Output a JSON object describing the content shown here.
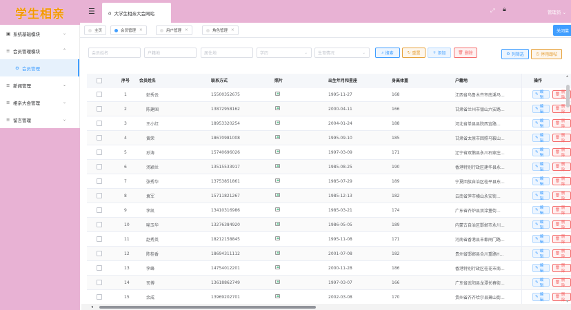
{
  "app": {
    "logo": "学生相亲"
  },
  "sidebar": {
    "items": [
      {
        "label": "系统基础模块",
        "icon": "book-icon",
        "chev": "⌄"
      },
      {
        "label": "会员管理模块",
        "icon": "list-icon",
        "chev": "⌃"
      },
      {
        "label": "会员管理",
        "icon": "gear-icon"
      },
      {
        "label": "新闻管理",
        "icon": "list-icon",
        "chev": "⌄"
      },
      {
        "label": "相亲大会管理",
        "icon": "list-icon",
        "chev": "⌄"
      },
      {
        "label": "留言管理",
        "icon": "list-icon",
        "chev": "⌄"
      }
    ]
  },
  "topbar": {
    "breadcrumb": "大学生相亲大会网站",
    "user": "管理员 ⌄"
  },
  "tags": {
    "items": [
      "主页",
      "会员管理",
      "用户管理",
      "角色管理"
    ],
    "close_all": "关闭菜"
  },
  "filters": {
    "member_name": "会员姓名",
    "origin": "户籍地",
    "address": "居住地",
    "education": "学历",
    "marital": "生育情况",
    "search": "搜索",
    "reset": "重置",
    "add": "添加",
    "delete": "删除",
    "columns": "列筛选",
    "sort": "停用跟帖"
  },
  "table": {
    "headers": [
      "序号",
      "会员姓名",
      "联系方式",
      "照片",
      "出生年月和星座",
      "身高体重",
      "户籍地",
      "操作"
    ],
    "edit_label": "编辑",
    "delete_label": "删除",
    "rows": [
      {
        "no": "1",
        "name": "彭秀云",
        "phone": "15500352675",
        "birth": "1995-11-27",
        "height": "168",
        "origin": "江西省乌鲁木齐市南溪马..."
      },
      {
        "no": "2",
        "name": "陈建国",
        "phone": "13872958162",
        "birth": "2000-04-11",
        "height": "166",
        "origin": "甘肃省兰州市银山六安路..."
      },
      {
        "no": "3",
        "name": "王小红",
        "phone": "18953320254",
        "birth": "2004-01-24",
        "height": "188",
        "origin": "河北省单县县院西宜路..."
      },
      {
        "no": "4",
        "name": "黄荣",
        "phone": "18670981008",
        "birth": "1995-09-10",
        "height": "185",
        "origin": "甘肃省太原市回照马鞍山..."
      },
      {
        "no": "5",
        "name": "孙涛",
        "phone": "15740696026",
        "birth": "1997-03-09",
        "height": "171",
        "origin": "辽宁省双鹅县永川石家庄..."
      },
      {
        "no": "6",
        "name": "汤颖兰",
        "phone": "13515533917",
        "birth": "1985-08-25",
        "height": "190",
        "origin": "香港特别行政区建华县永..."
      },
      {
        "no": "7",
        "name": "张秀华",
        "phone": "13753851861",
        "birth": "1985-07-29",
        "height": "189",
        "origin": "宁夏回族自治区桂平县东..."
      },
      {
        "no": "8",
        "name": "袁军",
        "phone": "15711821267",
        "birth": "1985-12-13",
        "height": "182",
        "origin": "云南省萍市横山永安街..."
      },
      {
        "no": "9",
        "name": "李凯",
        "phone": "13410316986",
        "birth": "1985-03-21",
        "height": "174",
        "origin": "广东省齐炉县双滦董街..."
      },
      {
        "no": "10",
        "name": "喻玉华",
        "phone": "13276384920",
        "birth": "1986-05-05",
        "height": "189",
        "origin": "内蒙古自治区邯郸市永川..."
      },
      {
        "no": "11",
        "name": "赵秀英",
        "phone": "18212158845",
        "birth": "1995-11-08",
        "height": "171",
        "origin": "河南省香港县丰都闸门路..."
      },
      {
        "no": "12",
        "name": "陈桂香",
        "phone": "18694311112",
        "birth": "2001-07-08",
        "height": "182",
        "origin": "贵州省邯郸县合川重路H..."
      },
      {
        "no": "13",
        "name": "李峰",
        "phone": "14754012201",
        "birth": "2000-11-28",
        "height": "186",
        "origin": "香港特别行政区桂花市南..."
      },
      {
        "no": "14",
        "name": "司博",
        "phone": "13618862749",
        "birth": "1997-03-07",
        "height": "166",
        "origin": "广东省武阳县龙潭长春街..."
      },
      {
        "no": "15",
        "name": "余成",
        "phone": "13969202701",
        "birth": "2002-03-08",
        "height": "170",
        "origin": "贵州省齐齐哈尔县萧山街..."
      }
    ]
  }
}
